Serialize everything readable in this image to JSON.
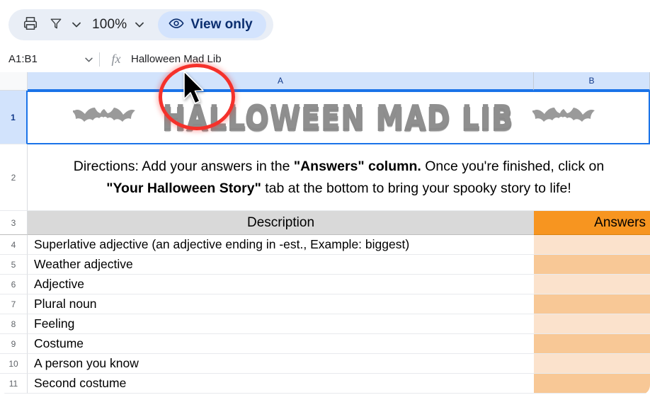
{
  "toolbar": {
    "print_icon": "print-icon",
    "filter_icon": "filter-icon",
    "filter_caret_icon": "chevron-down-icon",
    "zoom_level": "100%",
    "zoom_caret_icon": "chevron-down-icon",
    "view_only_icon": "eye-icon",
    "view_only_label": "View only"
  },
  "formula_bar": {
    "name_box_value": "A1:B1",
    "name_box_caret_icon": "chevron-down-icon",
    "fx_label": "fx",
    "formula_value": "Halloween Mad Lib"
  },
  "grid": {
    "columns": [
      {
        "label": "A"
      },
      {
        "label": "B"
      }
    ],
    "row1": {
      "number": "1",
      "title": "HALLOWEEN MAD LIB",
      "left_icon": "bat-icon",
      "right_icon": "bat-icon"
    },
    "row2": {
      "number": "2",
      "directions_line1_a": "Directions: Add your answers in the ",
      "directions_line1_b": "\"Answers\" column.",
      "directions_line1_c": " Once you're finished, click on",
      "directions_line2_a": "\"Your Halloween Story\"",
      "directions_line2_b": " tab at the bottom to bring your spooky story to life!"
    },
    "row3": {
      "number": "3",
      "header_description": "Description",
      "header_answers": "Answers"
    },
    "rows": [
      {
        "number": "4",
        "description": "Superlative adjective (an adjective ending in -est., Example: biggest)",
        "answer": "",
        "shade": "light"
      },
      {
        "number": "5",
        "description": "Weather adjective",
        "answer": "",
        "shade": "dark"
      },
      {
        "number": "6",
        "description": "Adjective",
        "answer": "",
        "shade": "light"
      },
      {
        "number": "7",
        "description": "Plural noun",
        "answer": "",
        "shade": "dark"
      },
      {
        "number": "8",
        "description": "Feeling",
        "answer": "",
        "shade": "light"
      },
      {
        "number": "9",
        "description": "Costume",
        "answer": "",
        "shade": "dark"
      },
      {
        "number": "10",
        "description": "A person you know",
        "answer": "",
        "shade": "light"
      },
      {
        "number": "11",
        "description": "Second costume",
        "answer": "",
        "shade": "dark"
      }
    ]
  },
  "annotation": {
    "highlight_icon": "red-circle-highlight",
    "cursor_icon": "mouse-cursor-icon"
  },
  "colors": {
    "accent_blue": "#1a73e8",
    "header_orange": "#f79520",
    "answer_light": "#fbe2cc",
    "answer_dark": "#f8c896",
    "header_gray": "#d9d9d9",
    "highlight_red": "#f5312b"
  }
}
